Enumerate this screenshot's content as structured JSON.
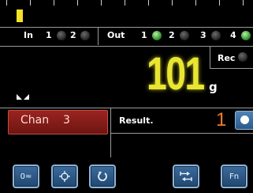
{
  "io": {
    "in_label": "In",
    "in_nums": [
      "1",
      "2"
    ],
    "out_label": "Out",
    "out_nums": [
      "1",
      "2",
      "3",
      "4"
    ],
    "out_states": [
      true,
      false,
      false,
      true
    ]
  },
  "display": {
    "weight": "101",
    "unit": "g",
    "rec_label": "Rec"
  },
  "chan": {
    "label": "Chan",
    "value": "3"
  },
  "result": {
    "label": "Result.",
    "value": "1"
  },
  "buttons": {
    "zero_label": "0≈",
    "fn_label": "Fn"
  },
  "colors": {
    "weight": "#e8e631",
    "result_value": "#f07a2a",
    "chan_bg": "#8a1f1b",
    "button_bg": "#2f5e8e",
    "led_on": "#39a831"
  }
}
